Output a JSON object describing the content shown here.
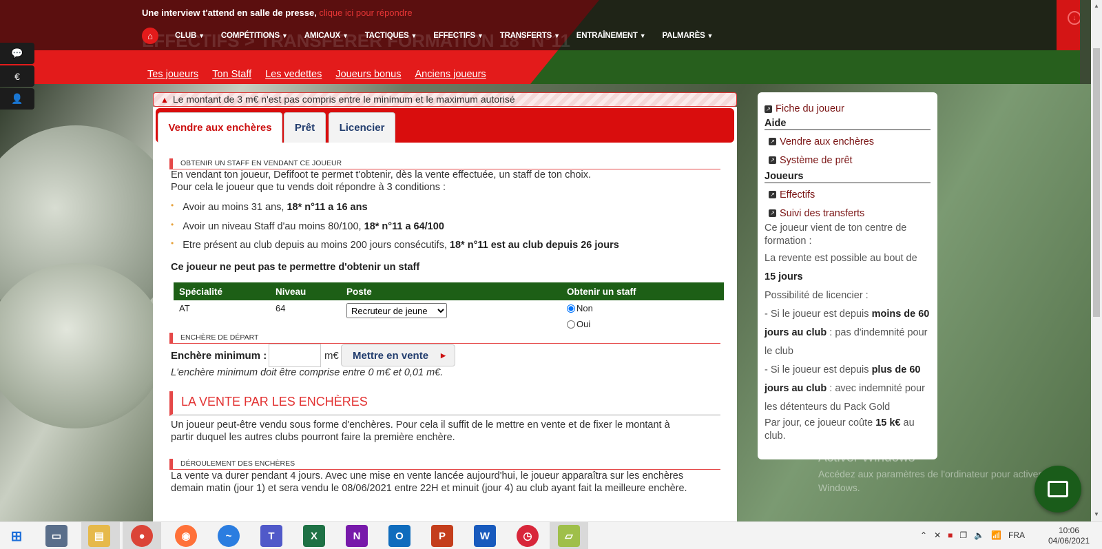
{
  "header": {
    "notice_text": "Une interview t'attend en salle de presse,",
    "notice_link": "clique ici pour répondre",
    "ghost_title": "EFFECTIFS > TRANSFÉRER FORMATION 18° N°11",
    "nav": [
      "CLUB",
      "COMPÉTITIONS",
      "AMICAUX",
      "TACTIQUES",
      "EFFECTIFS",
      "TRANSFERTS",
      "ENTRAÎNEMENT",
      "PALMARÈS"
    ],
    "subnav": [
      "Tes joueurs",
      "Ton Staff",
      "Les vedettes",
      "Joueurs bonus",
      "Anciens joueurs"
    ]
  },
  "alert": "Le montant de 3 m€ n'est pas compris entre le minimum et le maximum autorisé",
  "tabs": [
    "Vendre aux enchères",
    "Prêt",
    "Licencier"
  ],
  "staff_section": {
    "heading": "OBTENIR UN STAFF EN VENDANT CE JOUEUR",
    "intro1": "En vendant ton joueur, Defifoot te permet t'obtenir, dès la vente effectuée, un staff de ton choix.",
    "intro2": "Pour cela le joueur que tu vends doit répondre à 3 conditions :",
    "conditions": [
      {
        "text": "Avoir au moins 31 ans, ",
        "bold": "18* n°11 a 16 ans"
      },
      {
        "text": "Avoir un niveau Staff d'au moins 80/100, ",
        "bold": "18* n°11 a 64/100"
      },
      {
        "text": "Etre présent au club depuis au moins 200 jours consécutifs, ",
        "bold": "18* n°11 est au club depuis 26 jours"
      }
    ],
    "result": "Ce joueur ne peut pas te permettre d'obtenir un staff",
    "table": {
      "headers": [
        "Spécialité",
        "Niveau",
        "Poste",
        "Obtenir un staff"
      ],
      "row": {
        "specialite": "AT",
        "niveau": "64",
        "poste": "Recruteur de jeune",
        "opt_non": "Non",
        "opt_oui": "Oui"
      }
    }
  },
  "auction_start": {
    "heading": "ENCHÈRE DE DÉPART",
    "label": "Enchère minimum :",
    "value": "",
    "unit": "m€",
    "button": "Mettre en vente",
    "note": "L'enchère minimum doit être comprise entre 0 m€ et 0,01 m€."
  },
  "sale_section": {
    "heading": "LA VENTE PAR LES ENCHÈRES",
    "line1": "Un joueur peut-être vendu sous forme d'enchères. Pour cela il suffit de le mettre en vente et de fixer le montant à",
    "line2": "partir duquel les autres clubs pourront faire la première enchère."
  },
  "process_section": {
    "heading": "DÉROULEMENT DES ENCHÈRES",
    "line1": "La vente va durer pendant 4 jours. Avec une mise en vente lancée aujourd'hui, le joueur apparaîtra sur les enchères",
    "line2": "demain matin (jour 1) et sera vendu le 08/06/2021 entre 22H et minuit (jour 4) au club ayant fait la meilleure enchère."
  },
  "aside": {
    "fiche": "Fiche du joueur",
    "aide_title": "Aide",
    "aide_links": [
      "Vendre aux enchères",
      "Système de prêt"
    ],
    "joueurs_title": "Joueurs",
    "joueurs_links": [
      "Effectifs",
      "Suivi des transferts"
    ],
    "origin1": "Ce joueur vient de ton centre de",
    "origin2": "formation :",
    "resale": "La revente est possible au bout de",
    "resale_days": "15 jours",
    "licencier": "Possibilité de licencier :",
    "rule1a": "- Si le joueur est depuis ",
    "rule1b": "moins de 60",
    "rule1c": "jours au club",
    "rule1d": " : pas d'indemnité pour",
    "rule1e": "le club",
    "rule2a": "- Si le joueur est depuis ",
    "rule2b": "plus de 60",
    "rule2c": "jours au club",
    "rule2d": " : avec indemnité pour",
    "rule2e": "les détenteurs du Pack Gold",
    "cost1": "Par jour, ce joueur coûte ",
    "cost2": "15 k€",
    "cost3": " au",
    "cost4": "club."
  },
  "watermark": {
    "title": "Activer Windows",
    "sub1": "Accédez aux paramètres de l'ordinateur pour activer",
    "sub2": "Windows."
  },
  "taskbar": {
    "lang": "FRA",
    "time": "10:06",
    "date": "04/06/2021"
  }
}
